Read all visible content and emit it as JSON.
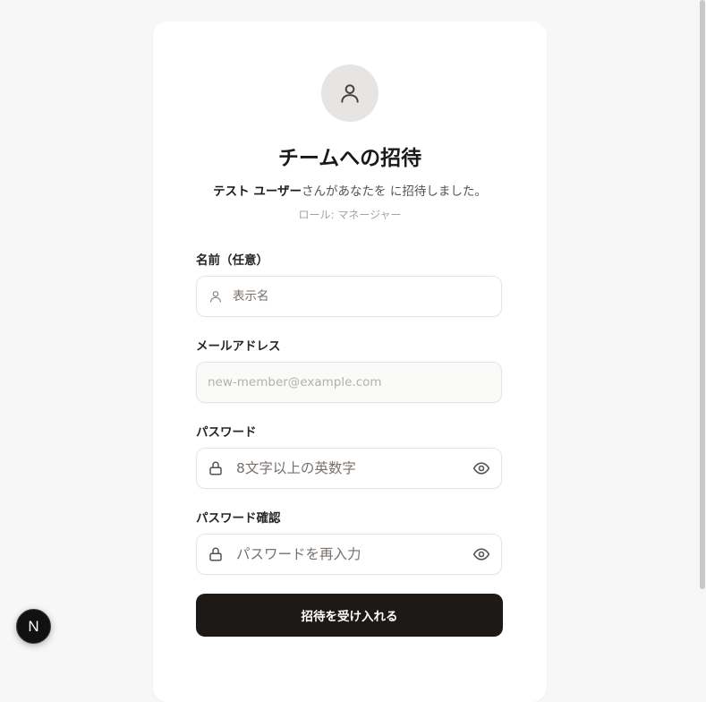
{
  "invite": {
    "title": "チームへの招待",
    "inviter_name": "テスト ユーザー",
    "invite_text": "さんがあなたを に招待しました。",
    "role_line": "ロール: マネージャー"
  },
  "form": {
    "name": {
      "label": "名前（任意）",
      "placeholder": "表示名",
      "icon": "user-icon"
    },
    "email": {
      "label": "メールアドレス",
      "placeholder": "new-member@example.com",
      "disabled": true
    },
    "password": {
      "label": "パスワード",
      "placeholder": "8文字以上の英数字",
      "icon": "lock-icon",
      "toggle_icon": "eye-icon"
    },
    "password_confirm": {
      "label": "パスワード確認",
      "placeholder": "パスワードを再入力",
      "icon": "lock-icon",
      "toggle_icon": "eye-icon"
    },
    "submit_label": "招待を受け入れる"
  },
  "dev_badge": {
    "label": "N",
    "icon": "nextjs-icon"
  },
  "colors": {
    "primary": "#1c1917",
    "background": "#f7f7f7",
    "avatar_bg": "#e7e5e4",
    "border": "#e7e5e4",
    "muted_text": "#78716c"
  }
}
